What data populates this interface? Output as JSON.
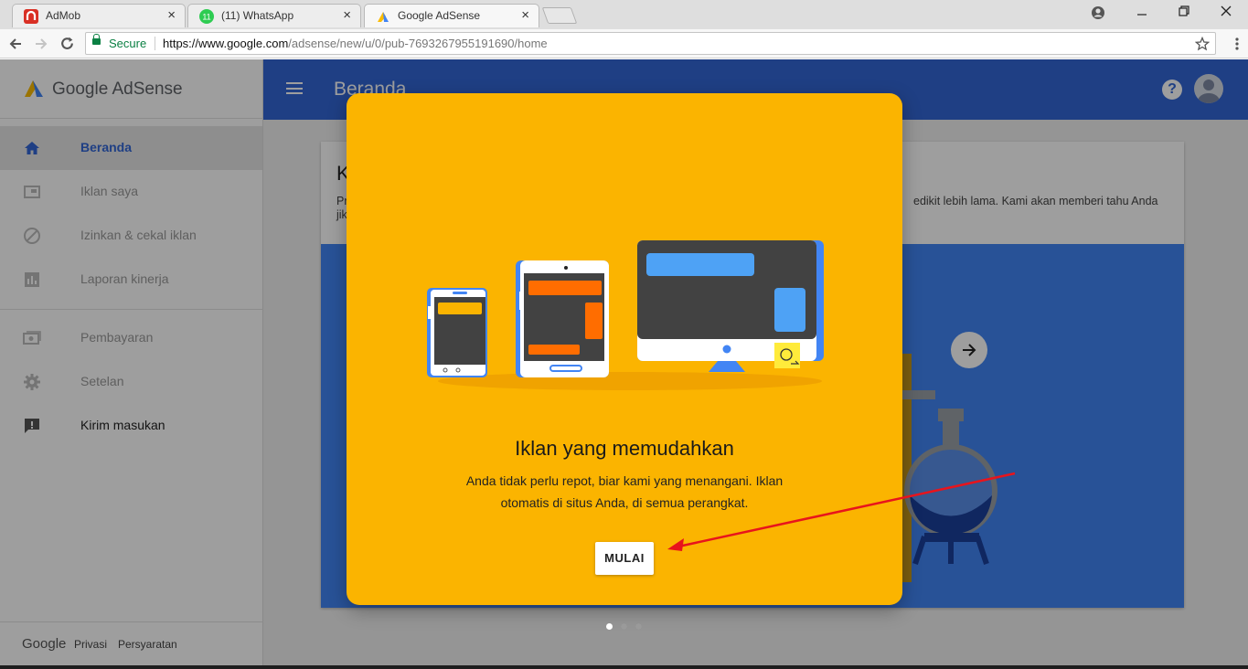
{
  "browser": {
    "tabs": [
      {
        "title": "AdMob",
        "icon": "admob-icon"
      },
      {
        "title": "(11) WhatsApp",
        "icon": "whatsapp-icon",
        "badge": "11"
      },
      {
        "title": "Google AdSense",
        "icon": "adsense-icon",
        "active": true
      }
    ],
    "close_glyph": "×",
    "secure_label": "Secure",
    "url_prefix": "https://www.google.com",
    "url_path": "/adsense/new/u/0/pub-7693267955191690/home"
  },
  "sidebar": {
    "brand": "Google AdSense",
    "items": [
      {
        "label": "Beranda",
        "icon": "home-icon",
        "active": true
      },
      {
        "label": "Iklan saya",
        "icon": "ads-icon"
      },
      {
        "label": "Izinkan & cekal iklan",
        "icon": "block-icon"
      },
      {
        "label": "Laporan kinerja",
        "icon": "report-icon"
      },
      {
        "label": "Pembayaran",
        "icon": "payment-icon"
      },
      {
        "label": "Setelan",
        "icon": "settings-icon"
      },
      {
        "label": "Kirim masukan",
        "icon": "feedback-icon"
      }
    ],
    "footer": {
      "google": "Google",
      "privacy": "Privasi",
      "terms": "Persyaratan"
    }
  },
  "appbar": {
    "title": "Beranda",
    "help": "?"
  },
  "card": {
    "heading": "K",
    "text_line1": "Pr",
    "text_line2": "jik",
    "text_right": "edikit lebih lama. Kami akan memberi tahu Anda"
  },
  "dialog": {
    "title": "Iklan yang memudahkan",
    "body": "Anda tidak perlu repot, biar kami yang menangani. Iklan otomatis di situs Anda, di semua perangkat.",
    "button": "MULAI"
  },
  "carousel": {
    "pages": 3,
    "current": 1
  },
  "colors": {
    "appbar": "#3367d6",
    "dialog": "#fbb400",
    "annotation_arrow": "#e8141c"
  }
}
